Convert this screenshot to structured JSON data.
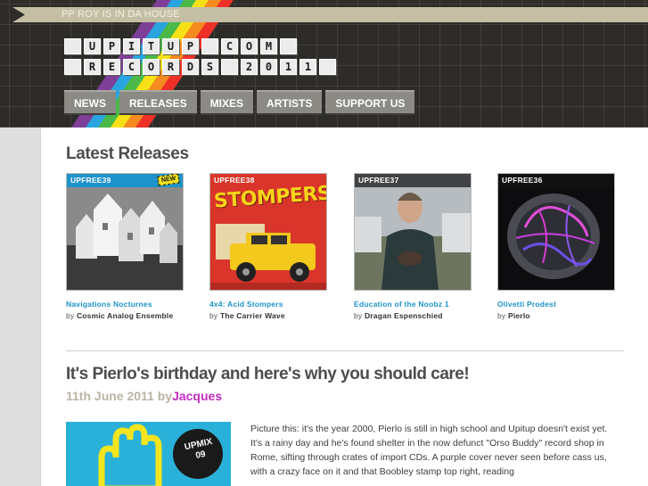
{
  "ribbon": {
    "text": "PP ROY IS IN DA HOUSE"
  },
  "logo": {
    "row1": [
      " ",
      "U",
      "P",
      "I",
      "T",
      "U",
      "P",
      " ",
      "C",
      "O",
      "M",
      " "
    ],
    "row2": [
      " ",
      "R",
      "E",
      "C",
      "O",
      "R",
      "D",
      "S",
      " ",
      "2",
      "0",
      "1",
      "1",
      " "
    ]
  },
  "nav": {
    "items": [
      "NEWS",
      "RELEASES",
      "MIXES",
      "ARTISTS",
      "SUPPORT US"
    ]
  },
  "latest": {
    "heading": "Latest Releases",
    "releases": [
      {
        "code": "UPFREE39",
        "badge": "NEW",
        "title": "Navigations Nocturnes",
        "by": "by",
        "artist": "Cosmic Analog Ensemble"
      },
      {
        "code": "UPFREE38",
        "badge": "",
        "title": "4x4: Acid Stompers",
        "by": "by",
        "artist": "The Carrier Wave",
        "cover_text": "STOMPERS"
      },
      {
        "code": "UPFREE37",
        "badge": "",
        "title": "Education of the Noobz 1",
        "by": "by",
        "artist": "Dragan Espenschied"
      },
      {
        "code": "UPFREE36",
        "badge": "",
        "title": "Olivetti Prodest",
        "by": "by",
        "artist": "Pierlo"
      }
    ]
  },
  "post": {
    "title": "It's Pierlo's birthday and here's why you should care!",
    "date": "11th June 2011",
    "by": "by",
    "author": "Jacques",
    "image_label": "UPMIX 09",
    "paragraph1": "Picture this: it's the year 2000, Pierlo is still in high school and Upitup doesn't exist yet.",
    "paragraph2": "It's a rainy day and he's found shelter in the now defunct \"Orso Buddy\" record shop in Rome, sifting through crates of import CDs. A purple cover never seen before cass us, with a crazy face on it and that Boobley stamp top right, reading"
  },
  "colors": {
    "header_bg": "#2e2c29",
    "ribbon": "#c4bfa4",
    "nav_button": "#8b8a85",
    "link_blue": "#1d93c9",
    "author_magenta": "#c12cc0",
    "date_tan": "#b9b4a3"
  }
}
